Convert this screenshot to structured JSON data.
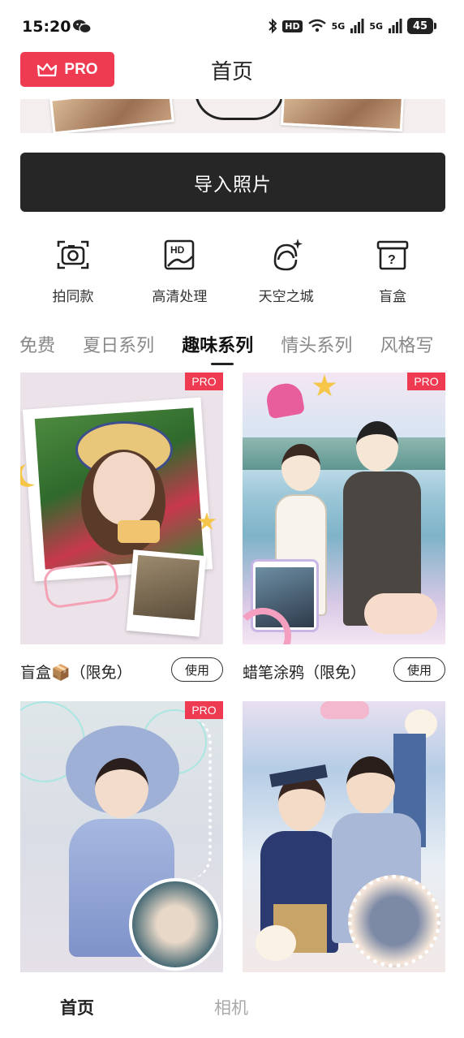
{
  "status_bar": {
    "time": "15:20",
    "hd_label": "HD",
    "signal1_label": "5G",
    "signal2_label": "5G",
    "battery": "45"
  },
  "header": {
    "pro_label": "PRO",
    "title": "首页"
  },
  "import_button": {
    "label": "导入照片"
  },
  "tools": [
    {
      "label": "拍同款",
      "icon": "camera-icon"
    },
    {
      "label": "高清处理",
      "icon": "hd-image-icon"
    },
    {
      "label": "天空之城",
      "icon": "sparkle-face-icon"
    },
    {
      "label": "盲盒",
      "icon": "mystery-box-icon"
    }
  ],
  "tabs": [
    {
      "label": "免费",
      "active": false
    },
    {
      "label": "夏日系列",
      "active": false
    },
    {
      "label": "趣味系列",
      "active": true
    },
    {
      "label": "情头系列",
      "active": false
    },
    {
      "label": "风格写",
      "active": false
    }
  ],
  "cards": [
    {
      "name": "盲盒📦（限免）",
      "badge": "PRO",
      "action": "使用"
    },
    {
      "name": "蜡笔涂鸦（限免）",
      "badge": "PRO",
      "action": "使用"
    },
    {
      "name": "",
      "badge": "PRO",
      "action": ""
    },
    {
      "name": "",
      "badge": "",
      "action": ""
    }
  ],
  "bottom_nav": [
    {
      "label": "首页",
      "active": true
    },
    {
      "label": "相机",
      "active": false
    }
  ],
  "colors": {
    "accent": "#ef3b52",
    "import_button": "#262626",
    "active_text": "#111111",
    "inactive_text": "#888888"
  }
}
